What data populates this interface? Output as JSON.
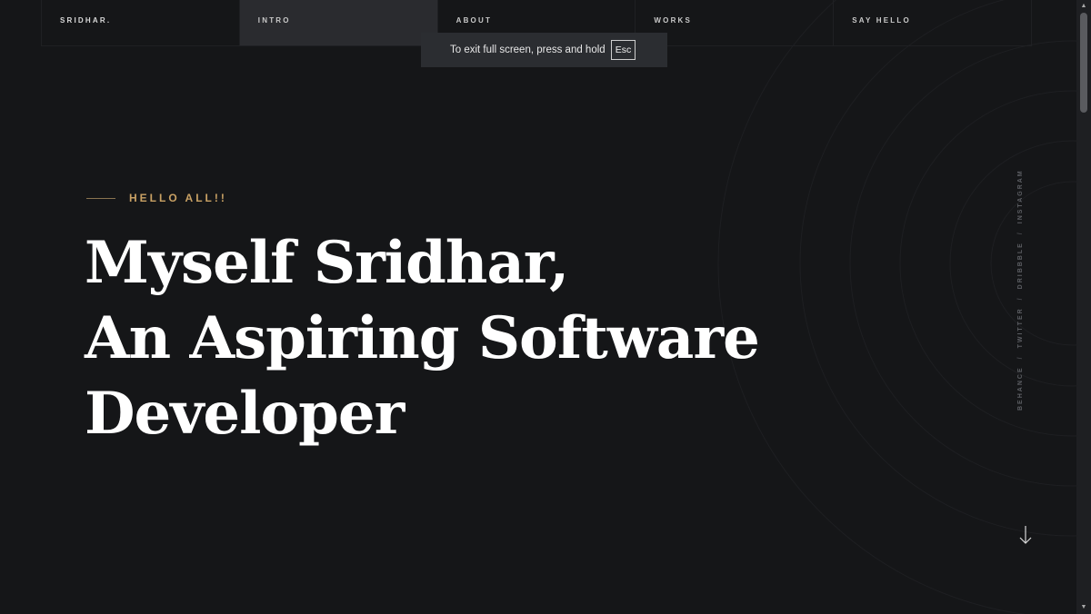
{
  "nav": {
    "brand": "SRIDHAR.",
    "items": [
      {
        "label": "INTRO",
        "active": true
      },
      {
        "label": "ABOUT",
        "active": false
      },
      {
        "label": "WORKS",
        "active": false
      },
      {
        "label": "SAY HELLO",
        "active": false
      }
    ]
  },
  "fullscreen_toast": {
    "message": "To exit full screen, press and hold",
    "key": "Esc"
  },
  "hero": {
    "kicker": "HELLO ALL!!",
    "title_lines": [
      "Myself Sridhar,",
      "An Aspiring Software",
      "Developer"
    ]
  },
  "social": {
    "links": [
      "BEHANCE",
      "TWITTER",
      "DRIBBBLE",
      "INSTAGRAM"
    ],
    "separator": "/"
  },
  "colors": {
    "background": "#151618",
    "accent": "#c9a164",
    "text": "#ffffff",
    "nav_active_bg": "#2a2b2f"
  },
  "icons": {
    "scroll_down": "arrow-down-icon",
    "scroll_up": "triangle-up-icon",
    "scroll_down_button": "triangle-down-icon"
  }
}
